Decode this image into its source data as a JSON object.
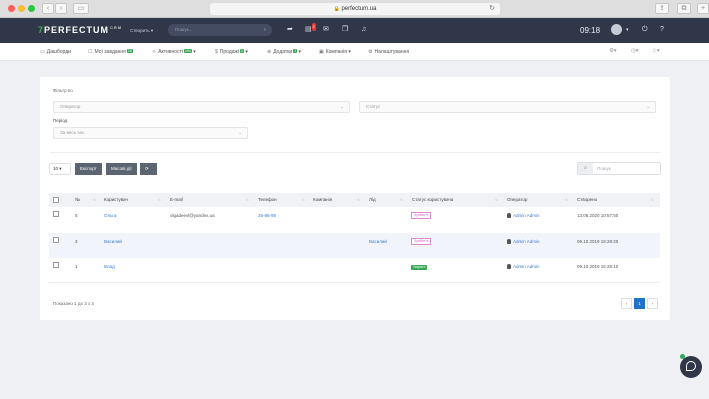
{
  "browser": {
    "url": "perfectum.ua",
    "lock": "🔒"
  },
  "header": {
    "logo_seven": "7",
    "logo_text": "PERFECTUM",
    "logo_crm": "CRM",
    "create_label": "Створить",
    "search_placeholder": "Пошук...",
    "notif_badge": "2",
    "time": "09:18"
  },
  "nav": {
    "items": [
      {
        "label": "Дашборди",
        "badge": ""
      },
      {
        "label": "Мої завдання",
        "badge": "25"
      },
      {
        "label": "Активності",
        "badge": "194"
      },
      {
        "label": "Продажі",
        "badge": "0"
      },
      {
        "label": "Додатки",
        "badge": "2"
      },
      {
        "label": "Компанія",
        "badge": ""
      },
      {
        "label": "Налаштування",
        "badge": ""
      }
    ]
  },
  "filters": {
    "title": "Фільтр по",
    "operator_placeholder": "Оператор",
    "status_placeholder": "Статус",
    "period_label": "Період",
    "period_value": "За весь час"
  },
  "toolbar": {
    "page_size": "10",
    "export_label": "Експорт",
    "bulk_label": "Масові дії",
    "search_placeholder": "Пошук"
  },
  "table": {
    "columns": [
      "№",
      "Користувач",
      "E-mail",
      "Телефон",
      "Компанія",
      "Лід",
      "Статус користувача",
      "Оператор",
      "Створено"
    ],
    "rows": [
      {
        "num": "5",
        "user": "Ольга",
        "email": "olgadeevl@yandex.ua",
        "phone": "26-86-98",
        "company": "",
        "lead": "",
        "status": "Зупбит",
        "status_type": "select",
        "operator": "Admin Admin",
        "created": "13.08.2020 10:57:50"
      },
      {
        "num": "3",
        "user": "Василий",
        "email": "",
        "phone": "",
        "company": "",
        "lead": "Василий",
        "status": "Зупбит",
        "status_type": "select",
        "operator": "Admin Admin",
        "created": "09.10.2019 16:28:20"
      },
      {
        "num": "1",
        "user": "Влад",
        "email": "",
        "phone": "",
        "company": "",
        "lead": "",
        "status": "Закрыто",
        "status_type": "closed",
        "operator": "Admin Admin",
        "created": "09.10.2019 16:28:10"
      }
    ]
  },
  "footer": {
    "summary": "Показано 1 до 3 з 3",
    "prev": "‹",
    "page": "1",
    "next": "›"
  }
}
